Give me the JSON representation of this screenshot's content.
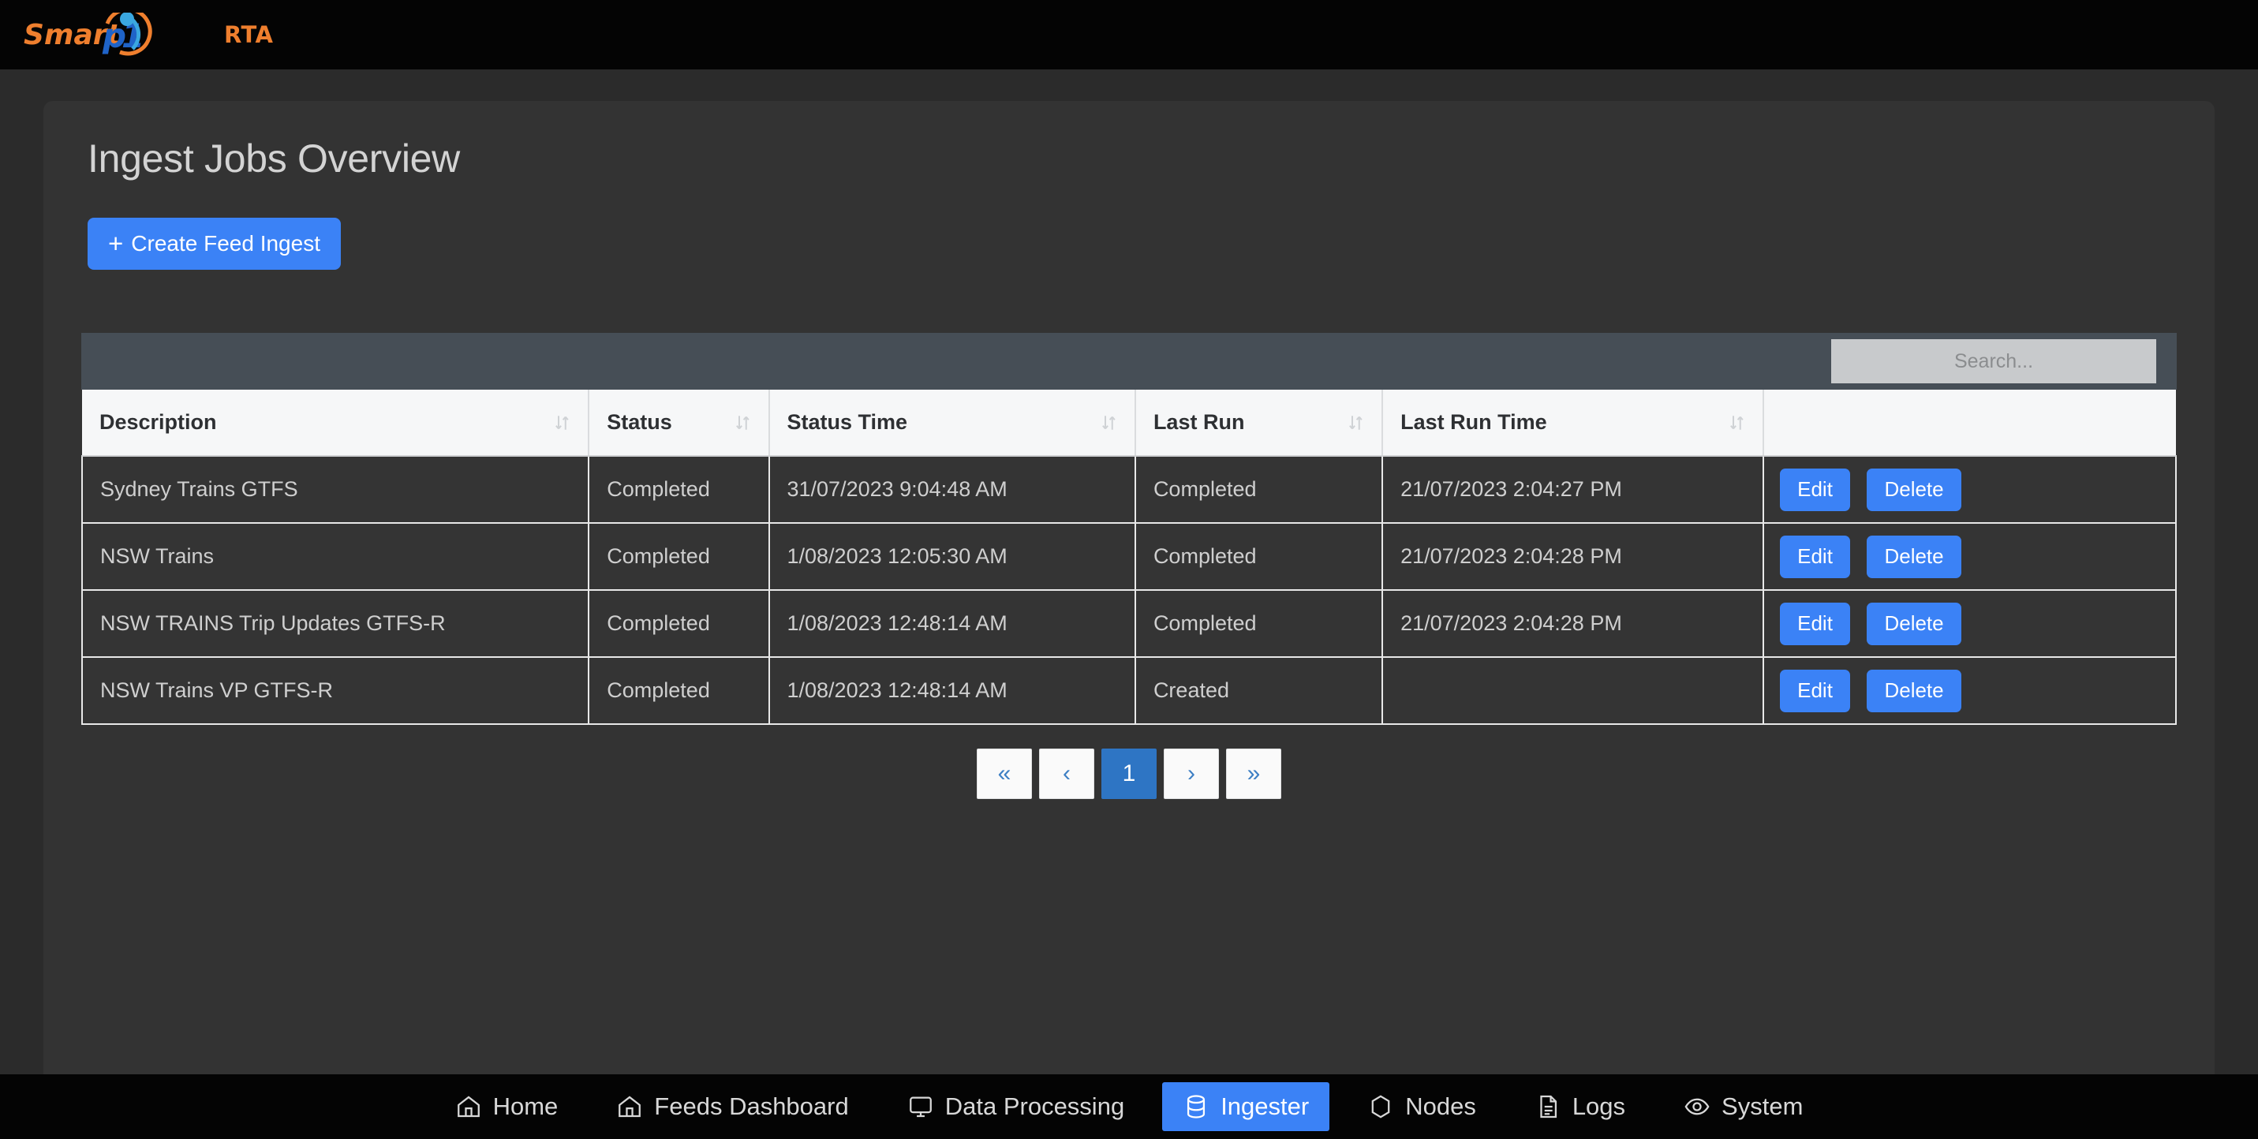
{
  "brand": {
    "word_smart": "Smart",
    "word_pi": "pi",
    "suffix": "RTA",
    "orange": "#ef7f2e",
    "blue": "#1f63c8",
    "light_blue": "#3aa7e0"
  },
  "page": {
    "title": "Ingest Jobs Overview",
    "create_button": "Create Feed Ingest",
    "create_button_icon": "plus-icon"
  },
  "search": {
    "placeholder": "Search...",
    "value": ""
  },
  "table": {
    "columns": [
      {
        "label": "Description",
        "sort_icon": "sort-updown-icon"
      },
      {
        "label": "Status",
        "sort_icon": "sort-updown-icon"
      },
      {
        "label": "Status Time",
        "sort_icon": "sort-updown-icon"
      },
      {
        "label": "Last Run",
        "sort_icon": "sort-updown-icon"
      },
      {
        "label": "Last Run Time",
        "sort_icon": "sort-updown-icon"
      },
      {
        "label": "",
        "sort_icon": ""
      }
    ],
    "rows": [
      {
        "description": "Sydney Trains GTFS",
        "status": "Completed",
        "status_time": "31/07/2023 9:04:48 AM",
        "last_run": "Completed",
        "last_run_time": "21/07/2023 2:04:27 PM",
        "edit": "Edit",
        "delete": "Delete"
      },
      {
        "description": "NSW Trains",
        "status": "Completed",
        "status_time": "1/08/2023 12:05:30 AM",
        "last_run": "Completed",
        "last_run_time": "21/07/2023 2:04:28 PM",
        "edit": "Edit",
        "delete": "Delete"
      },
      {
        "description": "NSW TRAINS Trip Updates GTFS-R",
        "status": "Completed",
        "status_time": "1/08/2023 12:48:14 AM",
        "last_run": "Completed",
        "last_run_time": "21/07/2023 2:04:28 PM",
        "edit": "Edit",
        "delete": "Delete"
      },
      {
        "description": "NSW Trains VP GTFS-R",
        "status": "Completed",
        "status_time": "1/08/2023 12:48:14 AM",
        "last_run": "Created",
        "last_run_time": "",
        "edit": "Edit",
        "delete": "Delete"
      }
    ]
  },
  "pagination": {
    "first": "«",
    "prev": "‹",
    "current": "1",
    "next": "›",
    "last": "»",
    "active_index": 2
  },
  "bottom_nav": {
    "items": [
      {
        "label": "Home",
        "icon": "home-icon",
        "active": false
      },
      {
        "label": "Feeds Dashboard",
        "icon": "home-icon",
        "active": false
      },
      {
        "label": "Data Processing",
        "icon": "monitor-icon",
        "active": false
      },
      {
        "label": "Ingester",
        "icon": "database-icon",
        "active": true
      },
      {
        "label": "Nodes",
        "icon": "hexagon-icon",
        "active": false
      },
      {
        "label": "Logs",
        "icon": "document-icon",
        "active": false
      },
      {
        "label": "System",
        "icon": "eye-icon",
        "active": false
      }
    ],
    "active_color": "#3b82f6"
  }
}
